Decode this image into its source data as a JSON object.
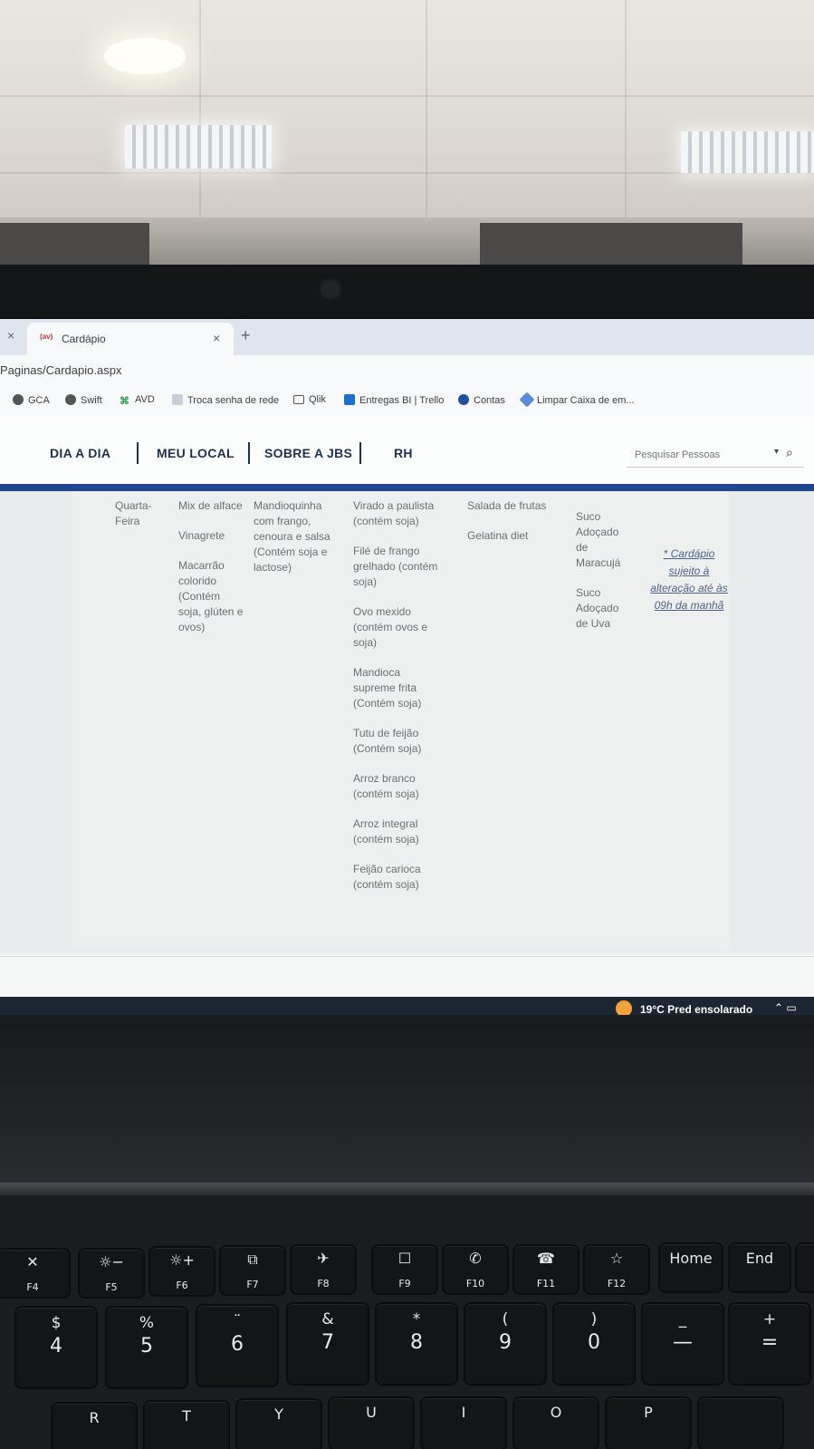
{
  "browser": {
    "tab_close": "×",
    "tab_favicon": "(av)",
    "tab_title": "Cardápio",
    "tab_x": "×",
    "tab_new": "+",
    "url": "Paginas/Cardapio.aspx"
  },
  "bookmarks": [
    {
      "label": "GCA",
      "icon": "globe-icon"
    },
    {
      "label": "Swift",
      "icon": "globe-icon"
    },
    {
      "label": "AVD",
      "icon": "avd-icon"
    },
    {
      "label": "Troca senha de rede",
      "icon": "document-icon"
    },
    {
      "label": "Qlik",
      "icon": "folder-icon"
    },
    {
      "label": "Entregas BI | Trello",
      "icon": "trello-icon"
    },
    {
      "label": "Contas",
      "icon": "contas-icon"
    },
    {
      "label": "Limpar Caixa de em...",
      "icon": "cube-icon"
    }
  ],
  "nav": {
    "items": [
      "DIA A DIA",
      "MEU LOCAL",
      "SOBRE A JBS",
      "RH"
    ],
    "search_placeholder": "Pesquisar Pessoas",
    "search_caret": "▾",
    "search_icon": "⌕"
  },
  "menu": {
    "day": [
      "Quarta-",
      "Feira"
    ],
    "salads": [
      "Mix de alface",
      "Vinagrete",
      "Macarrão colorido (Contém soja, glúten e ovos)"
    ],
    "main": [
      "Mandioquinha com frango, cenoura e salsa (Contém soja e lactose)"
    ],
    "sides": [
      "Virado a paulista (contém soja)",
      "Filé de frango grelhado (contém soja)",
      "Ovo mexido (contém ovos e soja)",
      "Mandioca supreme frita (Contém soja)",
      "Tutu de feijão (Contém soja)",
      "Arroz branco (contém soja)",
      "Arroz integral (contém soja)",
      "Feijão carioca (contém soja)"
    ],
    "desserts": [
      "Salada de frutas",
      "Gelatina diet"
    ],
    "drinks": [
      "Suco Adoçado de Maracujá",
      "Suco Adoçado de Uva"
    ],
    "note": "* Cardápio sujeito à alteração até às 09h da manhã"
  },
  "taskbar": {
    "weather": "19°C  Pred ensolarado",
    "tray": "⌃ ▭"
  },
  "keyboard": {
    "fn_keys": [
      {
        "icon": "✕",
        "label": "F4"
      },
      {
        "icon": "☼−",
        "label": "F5"
      },
      {
        "icon": "☼+",
        "label": "F6"
      },
      {
        "icon": "⧉",
        "label": "F7"
      },
      {
        "icon": "✈",
        "label": "F8"
      },
      {
        "icon": "☐",
        "label": "F9"
      },
      {
        "icon": "✆",
        "label": "F10"
      },
      {
        "icon": "☎",
        "label": "F11"
      },
      {
        "icon": "☆",
        "label": "F12"
      },
      {
        "icon": "Home",
        "label": ""
      },
      {
        "icon": "End",
        "label": ""
      }
    ],
    "num_keys": [
      {
        "sym": "$",
        "dig": "4"
      },
      {
        "sym": "%",
        "dig": "5"
      },
      {
        "sym": "¨",
        "dig": "6"
      },
      {
        "sym": "&",
        "dig": "7"
      },
      {
        "sym": "*",
        "dig": "8"
      },
      {
        "sym": "(",
        "dig": "9"
      },
      {
        "sym": ")",
        "dig": "0"
      },
      {
        "sym": "_",
        "dig": "—"
      },
      {
        "sym": "+",
        "dig": "="
      }
    ],
    "letter_keys": [
      "R",
      "T",
      "Y",
      "U",
      "I",
      "O",
      "P"
    ]
  }
}
